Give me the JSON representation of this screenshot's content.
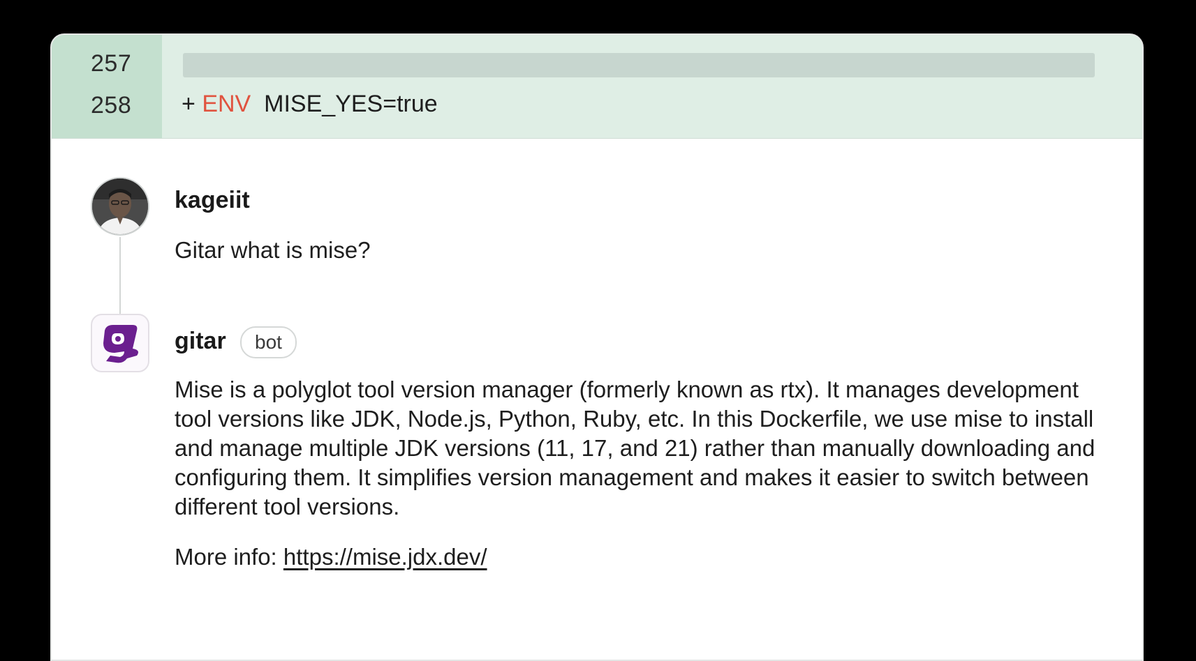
{
  "diff": {
    "line_numbers": [
      "257",
      "258"
    ],
    "added_line": {
      "prefix": "+",
      "keyword": "ENV",
      "content": "MISE_YES=true"
    }
  },
  "thread": {
    "comments": [
      {
        "author": "kageiit",
        "text": "Gitar what is mise?"
      },
      {
        "author": "gitar",
        "badge": "bot",
        "text": "Mise is a polyglot tool version manager (formerly known as rtx). It manages development tool versions like JDK, Node.js, Python, Ruby, etc. In this Dockerfile, we use mise to install and manage multiple JDK versions (11, 17, and 21) rather than manually downloading and configuring them. It simplifies version management and makes it easier to switch between different tool versions.",
        "more_info_label": "More info:",
        "more_info_link": "https://mise.jdx.dev/"
      }
    ]
  },
  "colors": {
    "diff_background": "#dfeee5",
    "gutter_background": "#c4e0cf",
    "keyword": "#e0533f",
    "bot_logo": "#6b1f8f"
  },
  "icons": {
    "user_avatar": "user-avatar-photo",
    "bot_avatar": "gitar-logo-icon"
  }
}
